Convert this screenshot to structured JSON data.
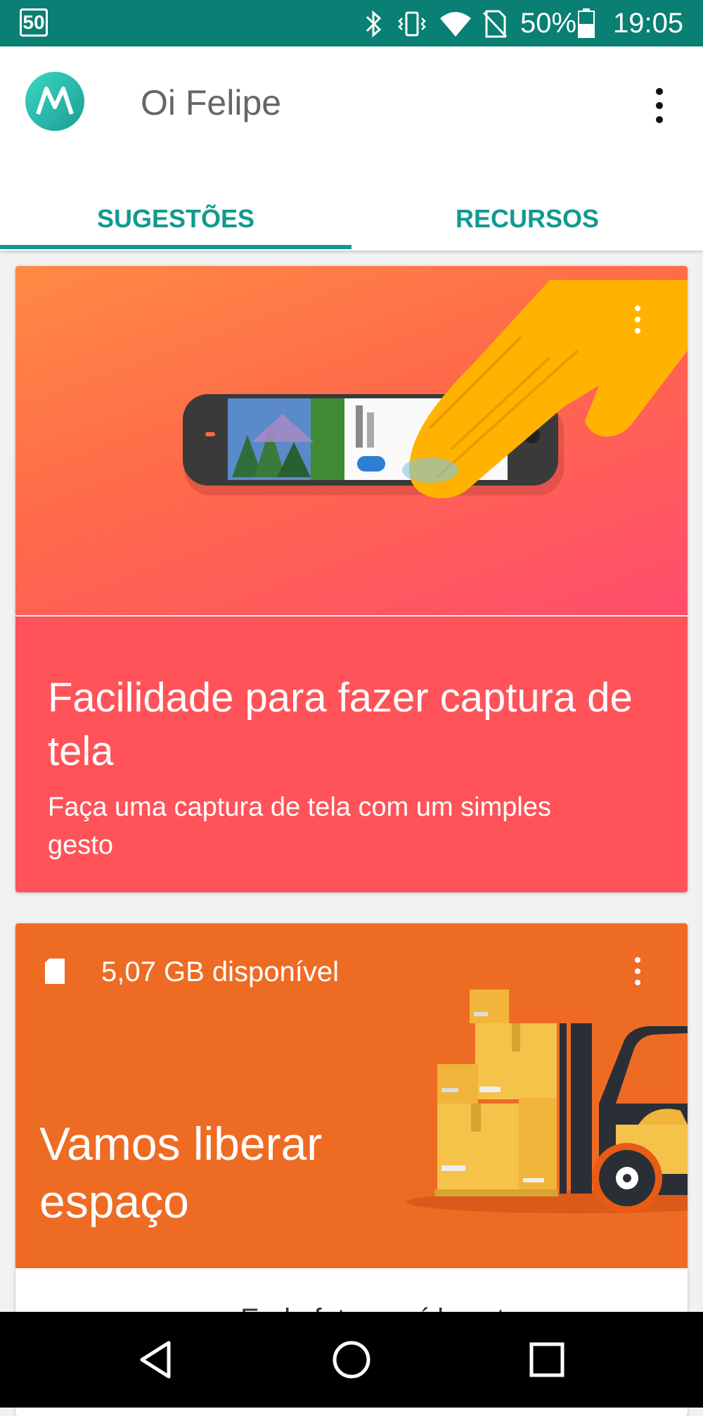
{
  "status_bar": {
    "badge": "50",
    "battery": "50%",
    "time": "19:05",
    "icons": [
      "bluetooth-icon",
      "vibrate-icon",
      "wifi-icon",
      "no-sim-icon",
      "battery-icon"
    ]
  },
  "app_bar": {
    "title": "Oi Felipe",
    "tabs": [
      {
        "label": "SUGESTÕES",
        "active": true
      },
      {
        "label": "RECURSOS",
        "active": false
      }
    ]
  },
  "cards": [
    {
      "title": "Facilidade para fazer captura de tela",
      "subtitle": "Faça uma captura de tela com um simples gesto"
    },
    {
      "storage": "5,07 GB disponível",
      "title": "Vamos liberar espaço",
      "next_item_partial": "Endo fotos e vídeos t"
    }
  ],
  "colors": {
    "status_bar": "#0a7f73",
    "accent": "#129a8f",
    "card1_body": "#ff5359",
    "card2_bg": "#ee6b24"
  }
}
